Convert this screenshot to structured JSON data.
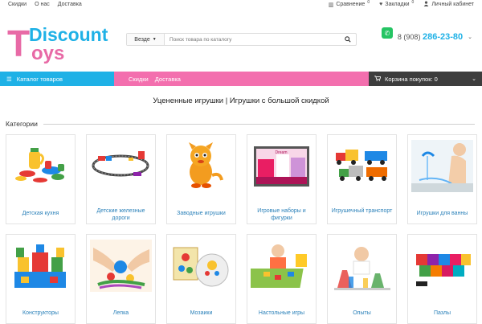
{
  "topbar": {
    "links": [
      "Скидки",
      "О нас",
      "Доставка"
    ],
    "compare": {
      "label": "Сравнение",
      "count": "0"
    },
    "bookmarks": {
      "label": "Закладки",
      "count": "0"
    },
    "cabinet": "Личный кабинет"
  },
  "logo": {
    "letter": "T",
    "word1": "Discount",
    "word2": "oys"
  },
  "search": {
    "scope": "Везде",
    "placeholder": "Поиск товара по каталогу"
  },
  "phone": {
    "prefix": "8 (908)",
    "number": "286-23-80"
  },
  "nav": {
    "catalog": "Каталог товаров",
    "links": [
      "Скидки",
      "Доставка"
    ],
    "cart_label": "Корзина покупок: 0"
  },
  "page_title": "Уцененные игрушки | Игрушки с большой скидкой",
  "section_title": "Категории",
  "categories": [
    {
      "name": "Детская кухня"
    },
    {
      "name": "Детские железные дороги"
    },
    {
      "name": "Заводные игрушки"
    },
    {
      "name": "Игровые наборы и фигурки"
    },
    {
      "name": "Игрушечный транспорт"
    },
    {
      "name": "Игрушки для ванны"
    },
    {
      "name": "Конструкторы"
    },
    {
      "name": "Лепка"
    },
    {
      "name": "Мозаики"
    },
    {
      "name": "Настольные игры"
    },
    {
      "name": "Опыты"
    },
    {
      "name": "Пазлы"
    }
  ],
  "colors": {
    "blue": "#1fb1e6",
    "pink": "#f36fae",
    "dark": "#3d3d3d",
    "whatsapp": "#25c463"
  }
}
